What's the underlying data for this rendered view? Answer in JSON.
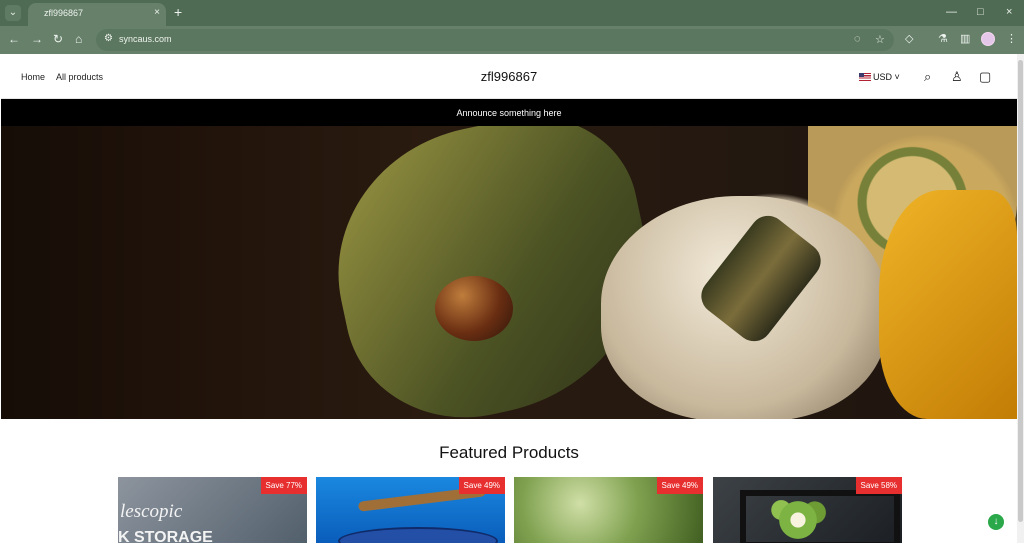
{
  "browser": {
    "tab_title": "zfl996867",
    "url": "syncaus.com",
    "icons": {
      "tab_menu": "chevron-down-icon",
      "close_tab": "close-icon",
      "new_tab": "plus-icon",
      "back": "back-arrow-icon",
      "forward": "forward-arrow-icon",
      "reload": "reload-icon",
      "home": "home-icon",
      "site_info": "site-info-icon",
      "hide": "eye-off-icon",
      "bookmark": "star-icon",
      "extensions": "puzzle-icon",
      "labs": "flask-icon",
      "sidebar": "sidebar-icon",
      "menu": "more-vertical-icon",
      "minimize": "minimize-icon",
      "maximize": "maximize-icon",
      "close_window": "close-window-icon"
    },
    "theme": {
      "frame": "#4f6b53",
      "toolbar": "#66806a"
    }
  },
  "site": {
    "nav": [
      "Home",
      "All products"
    ],
    "brand": "zfl996867",
    "currency": "USD",
    "announcement": "Announce something here",
    "icons": [
      "search-icon",
      "user-icon",
      "shopping-bag-icon"
    ],
    "featured_title": "Featured Products",
    "products": [
      {
        "badge": "Save 77%",
        "image_text_1": "lescopic",
        "image_text_2": "K STORAGE"
      },
      {
        "badge": "Save 49%"
      },
      {
        "badge": "Save 49%"
      },
      {
        "badge": "Save 58%"
      }
    ],
    "colors": {
      "accent_badge": "#e82f2f",
      "announcement_bg": "#000000"
    }
  }
}
